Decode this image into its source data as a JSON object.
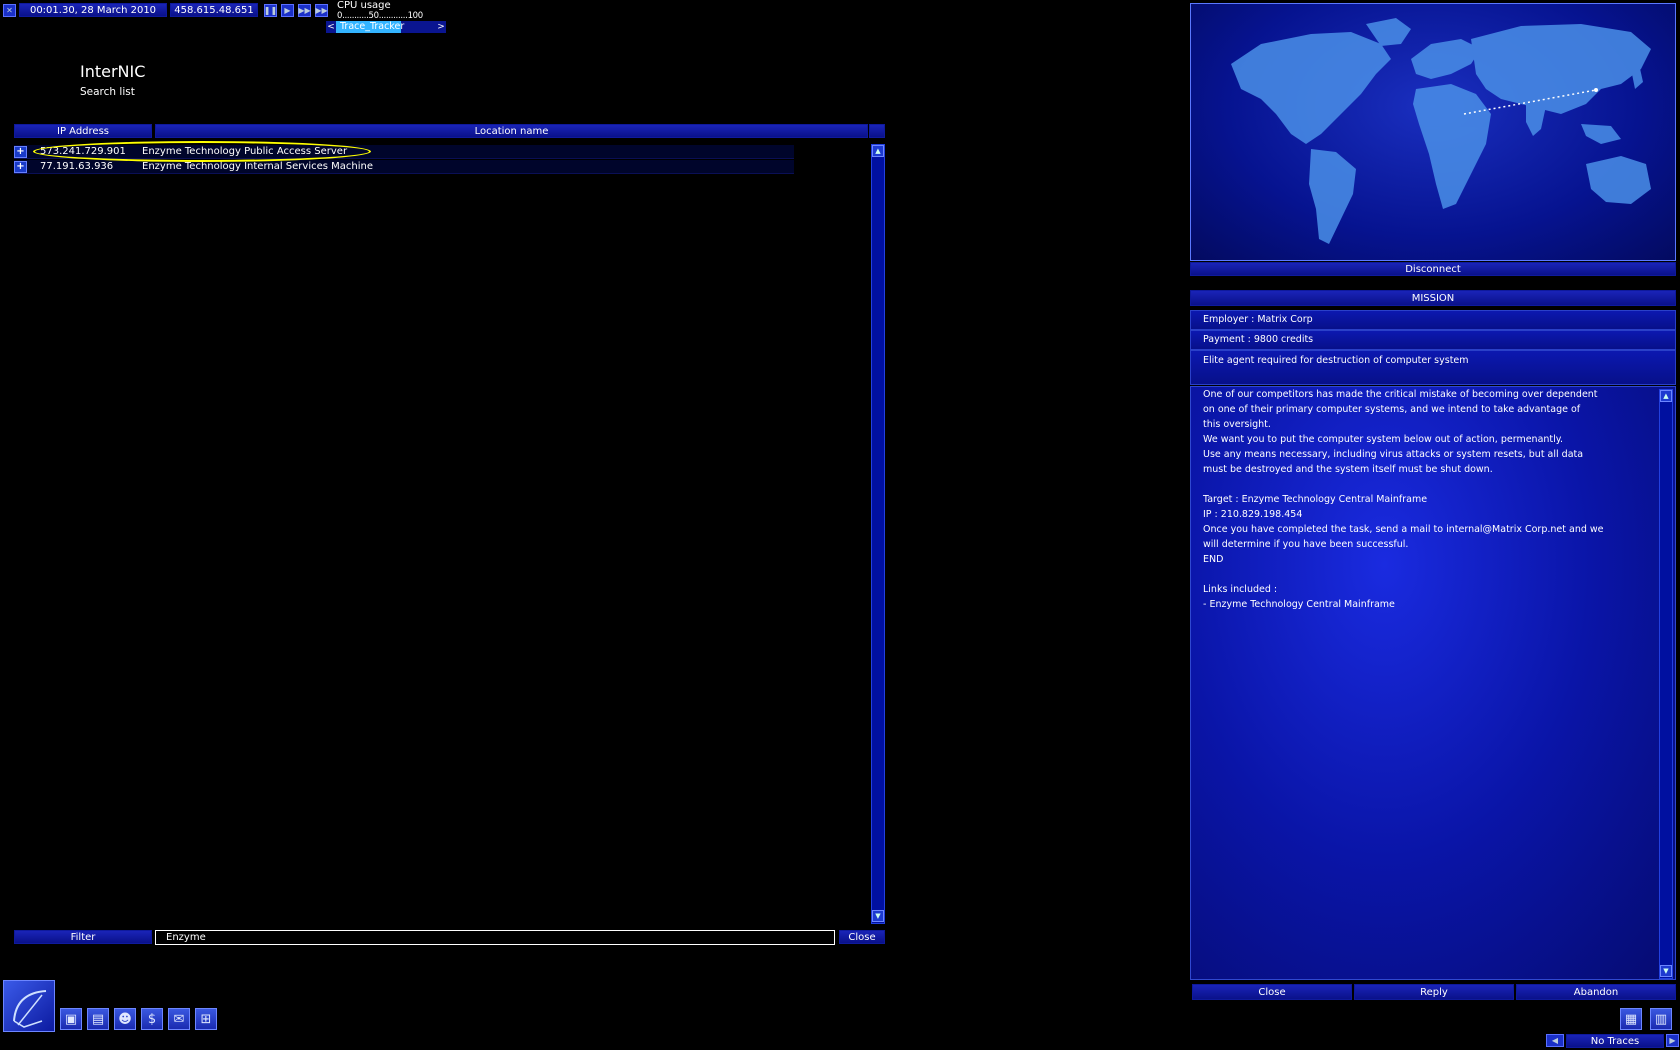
{
  "topbar": {
    "datetime": "00:01.30, 28 March 2010",
    "ip": "458.615.48.651",
    "cpu_label": "CPU usage",
    "cpu_scale": "0...........50............100",
    "tracker_label": "Trace_Tracker",
    "tracker_prev": "<",
    "tracker_next": ">"
  },
  "page": {
    "title": "InterNIC",
    "subtitle": "Search list"
  },
  "table": {
    "headers": [
      "IP Address",
      "Location name"
    ],
    "rows": [
      {
        "ip": "573.241.729.901",
        "location": "Enzyme Technology Public Access Server"
      },
      {
        "ip": "77.191.63.936",
        "location": "Enzyme Technology Internal Services Machine"
      }
    ]
  },
  "filter": {
    "button_label": "Filter",
    "value": "Enzyme",
    "close_label": "Close"
  },
  "map": {
    "disconnect_label": "Disconnect"
  },
  "mission": {
    "header": "MISSION",
    "employer": "Employer : Matrix Corp",
    "payment": "Payment : 9800 credits",
    "summary": "Elite agent required for destruction of computer system",
    "body_lines": [
      "One of our competitors has made the critical mistake of becoming over dependent",
      "on one of their primary computer systems, and we intend to take advantage of",
      "this oversight.",
      "We want you to put the computer system below out of action, permenantly.",
      "Use any means necessary, including virus attacks or system resets, but all data",
      "must be destroyed and the system itself must be shut down.",
      "",
      "Target : Enzyme Technology Central Mainframe",
      "IP : 210.829.198.454",
      "Once you have completed the task, send a mail to internal@Matrix Corp.net and we",
      "will determine if you have been successful.",
      "END",
      "",
      "Links included :",
      "- Enzyme Technology Central Mainframe"
    ],
    "buttons": {
      "close": "Close",
      "reply": "Reply",
      "abandon": "Abandon"
    }
  },
  "status": {
    "traces": "No Traces"
  },
  "colors": {
    "accent": "#1a24b8",
    "highlight": "#ffff00",
    "tracker": "#33b4ff"
  }
}
